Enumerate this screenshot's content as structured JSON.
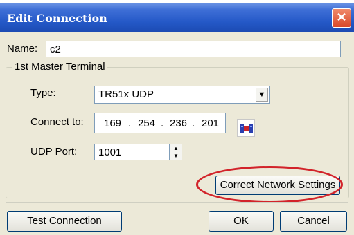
{
  "window": {
    "title": "Edit Connection",
    "close_glyph": "✕"
  },
  "name_field": {
    "label": "Name:",
    "value": "c2"
  },
  "group": {
    "title": "1st Master Terminal"
  },
  "type": {
    "label": "Type:",
    "value": "TR51x UDP"
  },
  "connect": {
    "label": "Connect to:",
    "ip": [
      "169",
      "254",
      "236",
      "201"
    ],
    "dot": ".",
    "icon": "network-icon"
  },
  "udp": {
    "label": "UDP Port:",
    "value": "1001"
  },
  "buttons": {
    "correct_network": "Correct Network Settings",
    "test_connection": "Test Connection",
    "ok": "OK",
    "cancel": "Cancel"
  },
  "colors": {
    "highlight": "#d2232a",
    "titlebar": "#2458c7"
  }
}
